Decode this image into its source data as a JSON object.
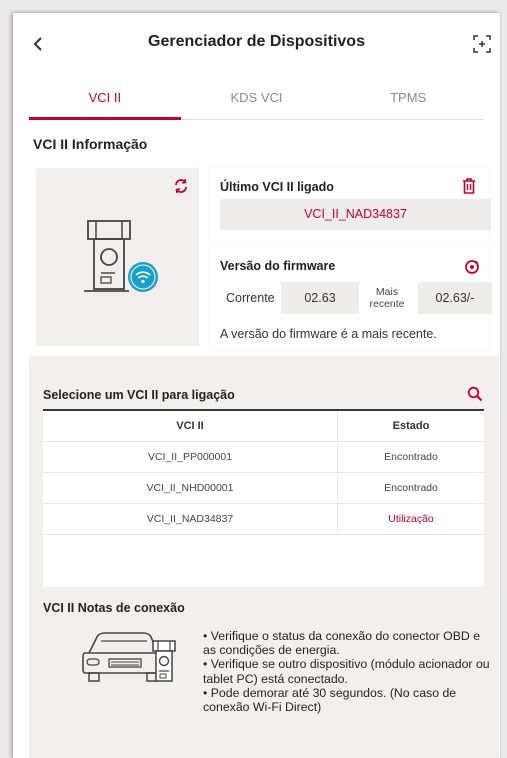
{
  "header": {
    "title": "Gerenciador de Dispositivos",
    "back_icon": "chevron-left-icon",
    "expand_icon": "expand-icon"
  },
  "tabs": [
    {
      "label": "VCI II",
      "active": true
    },
    {
      "label": "KDS VCI",
      "active": false
    },
    {
      "label": "TPMS",
      "active": false
    }
  ],
  "info": {
    "section_title": "VCI II Informação",
    "last_connected_label": "Último VCI II ligado",
    "last_connected_value": "VCI_II_NAD34837",
    "firmware_label": "Versão do firmware",
    "current_label": "Corrente",
    "current_value": "02.63",
    "latest_label": "Mais recente",
    "latest_value": "02.63/-",
    "firmware_message": "A versão do firmware é a mais recente."
  },
  "select": {
    "title": "Selecione um VCI II para ligação",
    "columns": [
      "VCI II",
      "Estado"
    ],
    "rows": [
      {
        "name": "VCI_II_PP000001",
        "status": "Encontrado"
      },
      {
        "name": "VCI_II_NHD00001",
        "status": "Encontrado"
      },
      {
        "name": "VCI_II_NAD34837",
        "status": "Utilização"
      }
    ]
  },
  "notes": {
    "title": "VCI II Notas de conexão",
    "lines": [
      "• Verifique o status da conexão do conector OBD e as condições de energia.",
      "• Verifique se outro dispositivo (módulo acionador ou tablet PC) está conectado.",
      "• Pode demorar até 30 segundos. (No caso de conexão Wi-Fi Direct)"
    ]
  },
  "colors": {
    "accent": "#c3002f",
    "panel": "#f3eeee",
    "wifi_badge": "#1aa0c8"
  }
}
